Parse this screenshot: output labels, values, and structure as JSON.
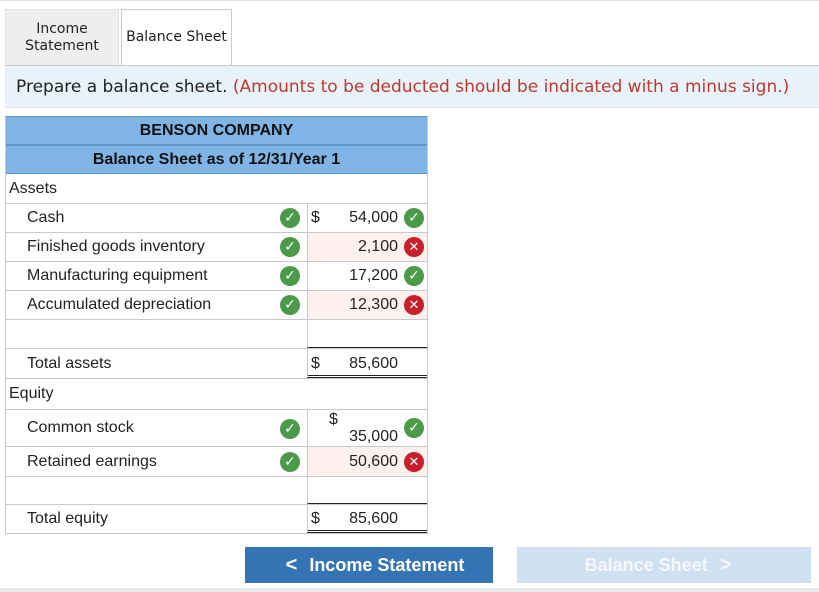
{
  "tabs": [
    {
      "label_line1": "Income",
      "label_line2": "Statement",
      "active": false
    },
    {
      "label": "Balance Sheet",
      "active": true
    }
  ],
  "instruction": {
    "text": "Prepare a balance sheet.",
    "note": "(Amounts to be deducted should be indicated with a minus sign.)"
  },
  "statement": {
    "company": "BENSON COMPANY",
    "subtitle": "Balance Sheet as of 12/31/Year 1",
    "assets_heading": "Assets",
    "assets": [
      {
        "label": "Cash",
        "dollar": "$",
        "amount": "54,000",
        "label_status": "correct",
        "amount_status": "correct"
      },
      {
        "label": "Finished goods inventory",
        "amount": "2,100",
        "label_status": "correct",
        "amount_status": "incorrect"
      },
      {
        "label": "Manufacturing equipment",
        "amount": "17,200",
        "label_status": "correct",
        "amount_status": "correct"
      },
      {
        "label": "Accumulated depreciation",
        "amount": "12,300",
        "label_status": "correct",
        "amount_status": "incorrect"
      }
    ],
    "total_assets": {
      "label": "Total assets",
      "dollar": "$",
      "amount": "85,600"
    },
    "equity_heading": "Equity",
    "equity": [
      {
        "label": "Common stock",
        "dollar": "$",
        "amount": "35,000",
        "label_status": "correct",
        "amount_status": "correct"
      },
      {
        "label": "Retained earnings",
        "amount": "50,600",
        "label_status": "correct",
        "amount_status": "incorrect"
      }
    ],
    "total_equity": {
      "label": "Total equity",
      "dollar": "$",
      "amount": "85,600"
    }
  },
  "icons": {
    "correct": "check-circle-icon",
    "incorrect": "x-circle-icon"
  },
  "colors": {
    "correct": "#4a9a4a",
    "incorrect": "#c8202a",
    "header": "#7fb4e4",
    "note": "#c0392b"
  },
  "nav": {
    "prev_label": "Income Statement",
    "prev_chevron": "<",
    "next_label": "Balance Sheet",
    "next_chevron": ">"
  }
}
